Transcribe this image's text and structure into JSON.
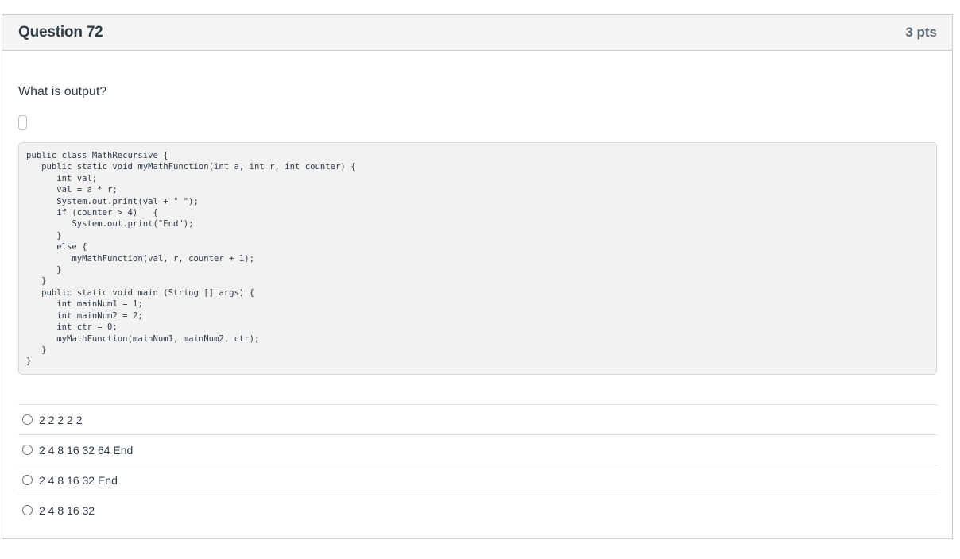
{
  "question": {
    "title": "Question 72",
    "points": "3 pts",
    "prompt": "What is output?",
    "code": "public class MathRecursive {\n   public static void myMathFunction(int a, int r, int counter) {\n      int val;\n      val = a * r;\n      System.out.print(val + \" \");\n      if (counter > 4)   {\n         System.out.print(\"End\");\n      }\n      else {\n         myMathFunction(val, r, counter + 1);\n      }\n   }\n   public static void main (String [] args) {\n      int mainNum1 = 1;\n      int mainNum2 = 2;\n      int ctr = 0;\n      myMathFunction(mainNum1, mainNum2, ctr);\n   }\n}",
    "answers": [
      {
        "label": "2 2 2 2 2"
      },
      {
        "label": "2 4 8 16 32 64 End"
      },
      {
        "label": "2 4 8 16 32 End"
      },
      {
        "label": "2 4 8 16 32"
      }
    ]
  }
}
